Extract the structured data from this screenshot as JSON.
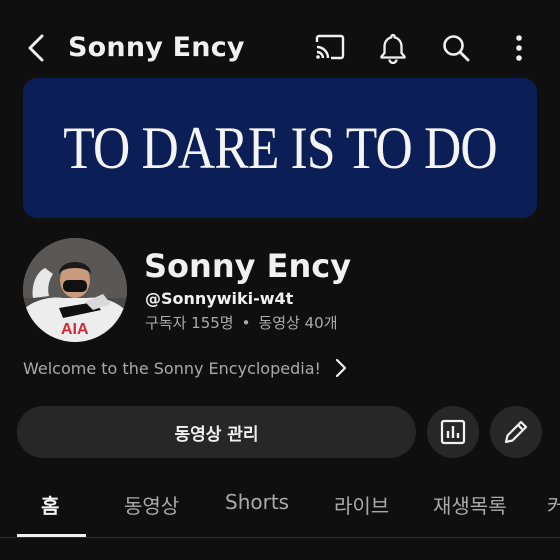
{
  "header": {
    "title": "Sonny Ency",
    "icons": [
      "back-arrow-icon",
      "cast-icon",
      "notifications-bell-icon",
      "search-icon",
      "more-vertical-icon"
    ]
  },
  "banner": {
    "text": "TO DARE IS TO DO",
    "background": "#0b1e55"
  },
  "channel": {
    "name": "Sonny Ency",
    "handle": "@Sonnywiki-w4t",
    "subscribers": "구독자 155명",
    "separator": "•",
    "videos": "동영상 40개",
    "description": "Welcome to the Sonny Encyclopedia!",
    "avatar_shirt_text": "AIA"
  },
  "actions": {
    "manage_label": "동영상 관리",
    "icons": [
      "analytics-icon",
      "edit-pencil-icon"
    ]
  },
  "tabs": [
    {
      "label": "홈",
      "active": true
    },
    {
      "label": "동영상",
      "active": false
    },
    {
      "label": "Shorts",
      "active": false
    },
    {
      "label": "라이브",
      "active": false
    },
    {
      "label": "재생목록",
      "active": false
    },
    {
      "label": "커",
      "active": false
    }
  ],
  "colors": {
    "background": "#0f0f0f",
    "button": "#272727",
    "text": "#f1f1f1",
    "muted": "#aaaaaa"
  }
}
